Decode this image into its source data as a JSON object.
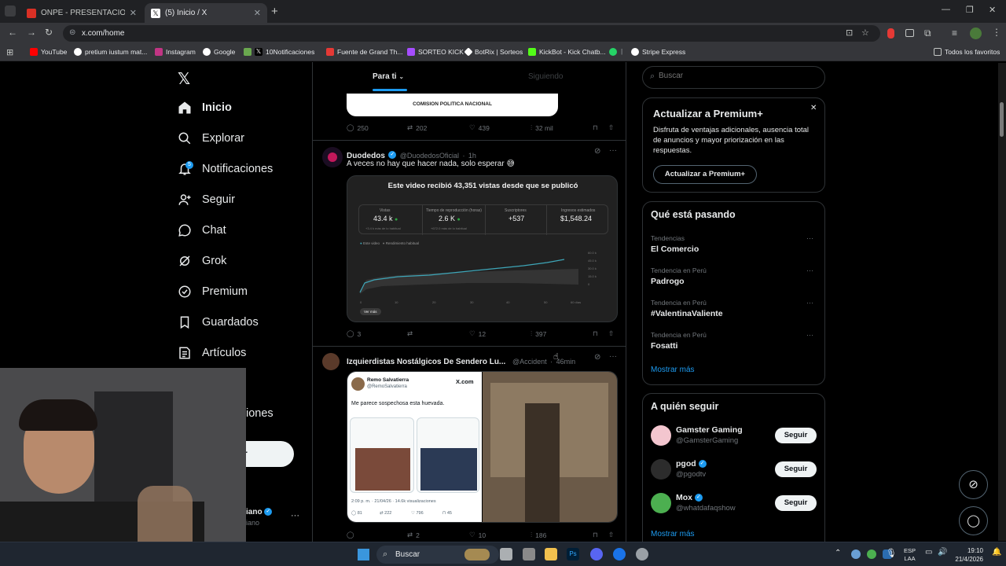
{
  "browser": {
    "tabs": [
      {
        "title": "ONPE - PRESENTACIÓN DE RES",
        "active": false
      },
      {
        "title": "(5) Inicio / X",
        "active": true
      }
    ],
    "url": "x.com/home",
    "bookmarks": [
      "YouTube",
      "pretium iustum mat...",
      "Instagram",
      "Google",
      "10Notificaciones",
      "Fuente de Grand Th...",
      "SORTEO KICK",
      "BotRix | Sorteos",
      "KickBot - Kick Chatb...",
      "Stripe Express"
    ],
    "bookmarks_folder": "Todos los favoritos"
  },
  "sidebar": {
    "items": [
      {
        "label": "Inicio",
        "icon": "home-icon",
        "active": true
      },
      {
        "label": "Explorar",
        "icon": "search-icon"
      },
      {
        "label": "Notificaciones",
        "icon": "bell-icon",
        "badge": "5"
      },
      {
        "label": "Seguir",
        "icon": "add-person-icon"
      },
      {
        "label": "Chat",
        "icon": "chat-icon"
      },
      {
        "label": "Grok",
        "icon": "grok-icon"
      },
      {
        "label": "Premium",
        "icon": "premium-icon"
      },
      {
        "label": "Guardados",
        "icon": "bookmark-icon"
      },
      {
        "label": "Artículos",
        "icon": "articles-icon"
      }
    ],
    "partial_item": "iones",
    "partial_button": "r",
    "partial_user": "iano",
    "partial_handle": "iano"
  },
  "feed": {
    "tabs": [
      "Para ti",
      "Siguiendo"
    ],
    "post0": {
      "image_caption": "COMISION POLITICA NACIONAL",
      "stats": {
        "replies": "250",
        "reposts": "202",
        "likes": "439",
        "views": "32 mil"
      }
    },
    "post1": {
      "name": "Duodedos",
      "handle": "@DuodedosOficial",
      "time": "1h",
      "text": "A veces no hay que hacer nada, solo esperar 😅",
      "card": {
        "title": "Este video recibió 43,351 vistas desde que se publicó",
        "metrics": [
          {
            "label": "Vistas",
            "value": "43.4 k",
            "sub": "+3.4 k más de lo habitual"
          },
          {
            "label": "Tiempo de reproducción (horas)",
            "value": "2.6 K",
            "sub": "+672.0 más de lo habitual"
          },
          {
            "label": "Suscriptores",
            "value": "+537",
            "sub": ""
          },
          {
            "label": "Ingresos estimados",
            "value": "$1,548.24",
            "sub": ""
          }
        ],
        "legend": [
          "Este video",
          "Rendimiento habitual"
        ],
        "x_ticks": [
          "0",
          "10",
          "20",
          "30",
          "40",
          "50",
          "60 días"
        ],
        "y_ticks": [
          "60.0 k",
          "45.0 k",
          "30.0 k",
          "15.0 k",
          "0"
        ],
        "button": "Ver más"
      },
      "stats": {
        "replies": "3",
        "reposts": "",
        "likes": "12",
        "views": "397"
      }
    },
    "post2": {
      "name": "Izquierdistas Nostálgicos De Sendero Lu...",
      "handle": "@Accident",
      "time": "46min",
      "quote": {
        "name": "Remo Salvatierra",
        "handle": "@RemoSalvatierra",
        "text": "Me parece sospechosa esta huevada.",
        "source": "X.com",
        "footer": "2:09 p. m. · 21/04/26 · 14.6k visualizaciones",
        "stats": [
          "81",
          "222",
          "796",
          "45"
        ]
      },
      "stats": {
        "replies": "",
        "reposts": "2",
        "likes": "10",
        "views": "186"
      }
    }
  },
  "right": {
    "search_placeholder": "Buscar",
    "premium": {
      "title": "Actualizar a Premium+",
      "text": "Disfruta de ventajas adicionales, ausencia total de anuncios y mayor priorización en las respuestas.",
      "button": "Actualizar a Premium+"
    },
    "trends": {
      "title": "Qué está pasando",
      "items": [
        {
          "label": "Tendencias",
          "name": "El Comercio"
        },
        {
          "label": "Tendencia en Perú",
          "name": "Padrogo"
        },
        {
          "label": "Tendencia en Perú",
          "name": "#ValentinaValiente"
        },
        {
          "label": "Tendencia en Perú",
          "name": "Fosatti"
        }
      ],
      "more": "Mostrar más"
    },
    "follow": {
      "title": "A quién seguir",
      "users": [
        {
          "name": "Gamster Gaming",
          "handle": "@GamsterGaming",
          "verified": false
        },
        {
          "name": "pgod",
          "handle": "@pgodtv",
          "verified": true
        },
        {
          "name": "Mox",
          "handle": "@whatdafaqshow",
          "verified": true
        }
      ],
      "button": "Seguir",
      "more": "Mostrar más"
    }
  },
  "taskbar": {
    "search": "Buscar",
    "lang": "ESP",
    "lang2": "LAA",
    "time": "19:10",
    "date": "21/4/2026"
  },
  "colors": {
    "accent": "#1d9bf0",
    "bg": "#000000",
    "border": "#2f3336",
    "muted": "#71767b"
  }
}
